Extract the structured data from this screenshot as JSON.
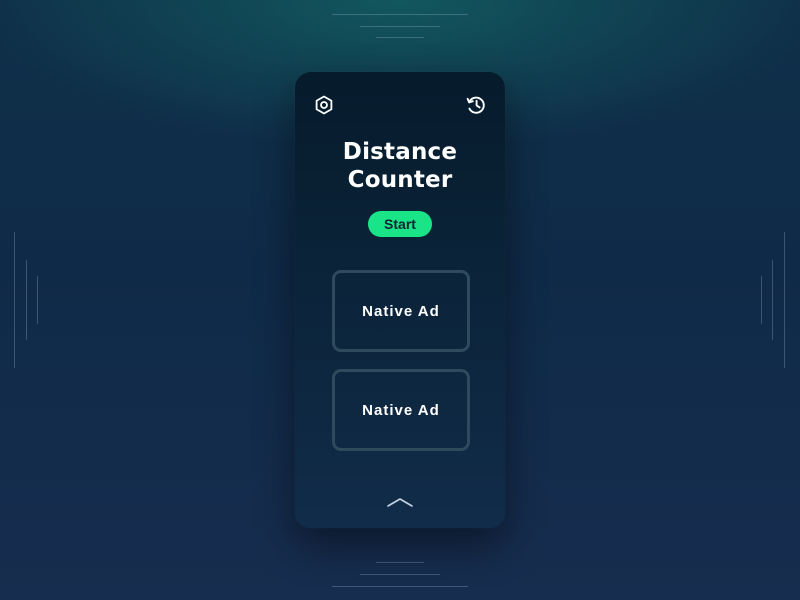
{
  "app": {
    "title_line1": "Distance",
    "title_line2": "Counter"
  },
  "toolbar": {
    "settings_icon": "gear-hex-icon",
    "history_icon": "history-icon"
  },
  "actions": {
    "start_label": "Start"
  },
  "ads": [
    {
      "label": "Native Ad"
    },
    {
      "label": "Native Ad"
    }
  ],
  "footer": {
    "expand_icon": "chevron-up-icon"
  },
  "colors": {
    "accent": "#19e588",
    "phone_bg": "#0a2236",
    "ad_border": "#2f4a5d"
  }
}
